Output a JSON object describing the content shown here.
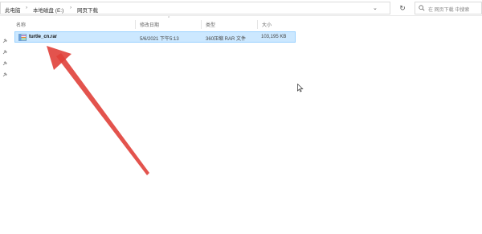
{
  "address_bar": {
    "crumbs": [
      "此电脑",
      "本地磁盘 (E:)",
      "网页下载"
    ]
  },
  "search": {
    "placeholder": "在 网页下载 中搜索"
  },
  "columns": {
    "name": "名称",
    "modified": "修改日期",
    "type": "类型",
    "size": "大小"
  },
  "files": [
    {
      "name": "turtle_cn.rar",
      "modified": "5/6/2021 下午5:13",
      "type": "360压缩 RAR 文件",
      "size": "103,195 KB",
      "icon": "rar-archive-icon"
    }
  ],
  "colors": {
    "selection_bg": "#cce8ff",
    "selection_border": "#99d1ff",
    "arrow": "#e0403a"
  }
}
